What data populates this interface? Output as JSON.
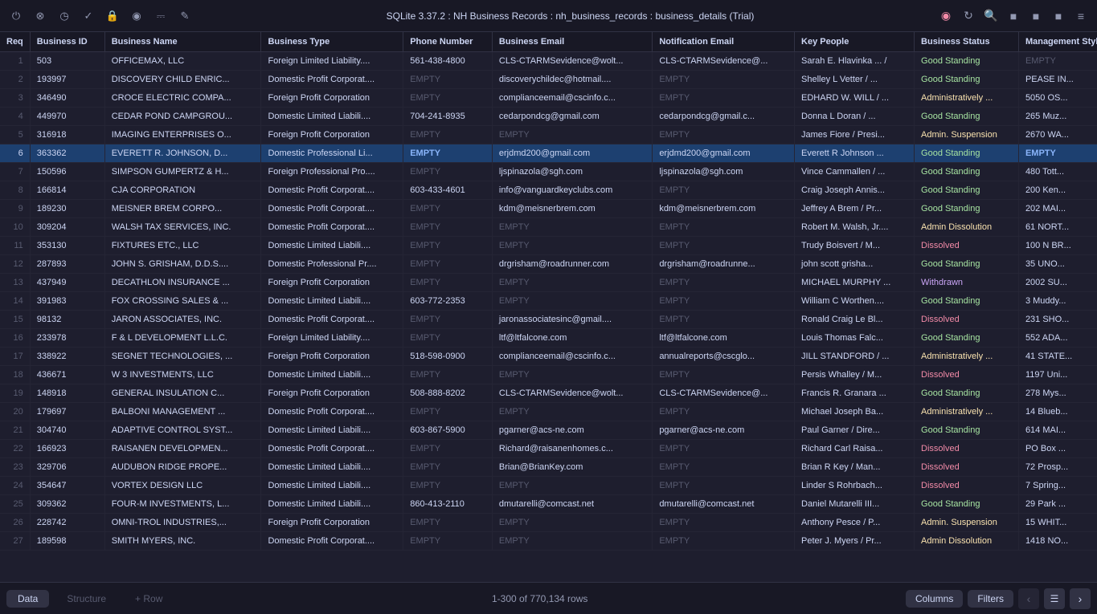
{
  "app": {
    "title": "SQLite 3.37.2  :  NH Business Records  :  nh_business_records  :  business_details (Trial)"
  },
  "titlebar": {
    "icons": [
      {
        "name": "power-icon",
        "symbol": "⏻"
      },
      {
        "name": "stop-icon",
        "symbol": "⊗"
      },
      {
        "name": "history-icon",
        "symbol": "◷"
      },
      {
        "name": "check-icon",
        "symbol": "✓"
      },
      {
        "name": "lock-icon",
        "symbol": "🔒"
      },
      {
        "name": "shield-icon",
        "symbol": "🛡"
      },
      {
        "name": "inbox-icon",
        "symbol": "⊟"
      },
      {
        "name": "edit-icon",
        "symbol": "✎"
      }
    ],
    "right_icons": [
      {
        "name": "stop-red-icon",
        "symbol": "⊗",
        "style": "red"
      },
      {
        "name": "refresh-icon",
        "symbol": "↻"
      },
      {
        "name": "search-icon",
        "symbol": "🔍"
      },
      {
        "name": "layout1-icon",
        "symbol": "⬜"
      },
      {
        "name": "layout2-icon",
        "symbol": "⬜"
      },
      {
        "name": "layout3-icon",
        "symbol": "⬜"
      },
      {
        "name": "menu-icon",
        "symbol": "≡"
      }
    ]
  },
  "columns": [
    {
      "id": "req",
      "label": "Req"
    },
    {
      "id": "business_id",
      "label": "Business ID"
    },
    {
      "id": "business_name",
      "label": "Business Name"
    },
    {
      "id": "business_type",
      "label": "Business Type"
    },
    {
      "id": "phone_number",
      "label": "Phone Number"
    },
    {
      "id": "business_email",
      "label": "Business Email"
    },
    {
      "id": "notification_email",
      "label": "Notification Email"
    },
    {
      "id": "key_people",
      "label": "Key People"
    },
    {
      "id": "business_status",
      "label": "Business Status"
    },
    {
      "id": "management_style",
      "label": "Management Style"
    }
  ],
  "rows": [
    {
      "num": "1",
      "id": "503",
      "name": "OFFICEMAX, LLC",
      "type": "Foreign Limited Liability....",
      "phone": "561-438-4800",
      "email": "CLS-CTARMSevidence@wolt...",
      "notif": "CLS-CTARMSevidence@...",
      "people": "Sarah E. Hlavinka ... /",
      "status": "Good Standing",
      "status_class": "status-good",
      "mgmt": "EMPTY",
      "mgmt_class": "empty",
      "selected": false
    },
    {
      "num": "2",
      "id": "193997",
      "name": "DISCOVERY CHILD ENRIC...",
      "type": "Domestic Profit Corporat....",
      "phone": "EMPTY",
      "email": "discoverychildec@hotmail....",
      "notif": "EMPTY",
      "people": "Shelley L Vetter / ...",
      "status": "Good Standing",
      "status_class": "status-good",
      "mgmt": "PEASE IN...",
      "mgmt_class": "",
      "selected": false
    },
    {
      "num": "3",
      "id": "346490",
      "name": "CROCE ELECTRIC COMPA...",
      "type": "Foreign Profit Corporation",
      "phone": "EMPTY",
      "email": "complianceemail@cscinfo.c...",
      "notif": "EMPTY",
      "people": "EDHARD W. WILL / ...",
      "status": "Administratively ...",
      "status_class": "status-admin",
      "mgmt": "5050 OS...",
      "mgmt_class": "",
      "selected": false
    },
    {
      "num": "4",
      "id": "449970",
      "name": "CEDAR POND CAMPGROU...",
      "type": "Domestic Limited Liabili....",
      "phone": "704-241-8935",
      "email": "cedarpondcg@gmail.com",
      "notif": "cedarpondcg@gmail.c...",
      "people": "Donna L Doran / ...",
      "status": "Good Standing",
      "status_class": "status-good",
      "mgmt": "265 Muz...",
      "mgmt_class": "",
      "selected": false
    },
    {
      "num": "5",
      "id": "316918",
      "name": "IMAGING ENTERPRISES O...",
      "type": "Foreign Profit Corporation",
      "phone": "EMPTY",
      "email": "EMPTY",
      "notif": "EMPTY",
      "people": "James Fiore / Presi...",
      "status": "Admin. Suspension",
      "status_class": "status-admin",
      "mgmt": "2670 WA...",
      "mgmt_class": "",
      "selected": false
    },
    {
      "num": "6",
      "id": "363362",
      "name": "EVERETT R. JOHNSON, D...",
      "type": "Domestic Professional Li...",
      "phone": "EMPTY",
      "email": "erjdmd200@gmail.com",
      "notif": "erjdmd200@gmail.com",
      "people": "Everett R Johnson ...",
      "status": "Good Standing",
      "status_class": "status-good",
      "mgmt": "EMPTY",
      "mgmt_class": "empty",
      "selected": true
    },
    {
      "num": "7",
      "id": "150596",
      "name": "SIMPSON GUMPERTZ & H...",
      "type": "Foreign Professional Pro....",
      "phone": "EMPTY",
      "email": "ljspinazola@sgh.com",
      "notif": "ljspinazola@sgh.com",
      "people": "Vince Cammallen / ...",
      "status": "Good Standing",
      "status_class": "status-good",
      "mgmt": "480 Tott...",
      "mgmt_class": "",
      "selected": false
    },
    {
      "num": "8",
      "id": "166814",
      "name": "CJA CORPORATION",
      "type": "Domestic Profit Corporat....",
      "phone": "603-433-4601",
      "email": "info@vanguardkeyclubs.com",
      "notif": "EMPTY",
      "people": "Craig Joseph Annis...",
      "status": "Good Standing",
      "status_class": "status-good",
      "mgmt": "200 Ken...",
      "mgmt_class": "",
      "selected": false
    },
    {
      "num": "9",
      "id": "189230",
      "name": "MEISNER BREM CORPO...",
      "type": "Domestic Profit Corporat....",
      "phone": "EMPTY",
      "email": "kdm@meisnerbrem.com",
      "notif": "kdm@meisnerbrem.com",
      "people": "Jeffrey A Brem / Pr...",
      "status": "Good Standing",
      "status_class": "status-good",
      "mgmt": "202 MAI...",
      "mgmt_class": "",
      "selected": false
    },
    {
      "num": "10",
      "id": "309204",
      "name": "WALSH TAX SERVICES, INC.",
      "type": "Domestic Profit Corporat....",
      "phone": "EMPTY",
      "email": "EMPTY",
      "notif": "EMPTY",
      "people": "Robert M. Walsh, Jr....",
      "status": "Admin Dissolution",
      "status_class": "status-admin",
      "mgmt": "61 NORT...",
      "mgmt_class": "",
      "selected": false
    },
    {
      "num": "11",
      "id": "353130",
      "name": "FIXTURES ETC., LLC",
      "type": "Domestic Limited Liabili....",
      "phone": "EMPTY",
      "email": "EMPTY",
      "notif": "EMPTY",
      "people": "Trudy Boisvert / M...",
      "status": "Dissolved",
      "status_class": "status-dissolved",
      "mgmt": "100 N BR...",
      "mgmt_class": "",
      "selected": false
    },
    {
      "num": "12",
      "id": "287893",
      "name": "JOHN S. GRISHAM, D.D.S....",
      "type": "Domestic Professional Pr....",
      "phone": "EMPTY",
      "email": "drgrisham@roadrunner.com",
      "notif": "drgrisham@roadrunne...",
      "people": "john scott grisha...",
      "status": "Good Standing",
      "status_class": "status-good",
      "mgmt": "35 UNO...",
      "mgmt_class": "",
      "selected": false
    },
    {
      "num": "13",
      "id": "437949",
      "name": "DECATHLON INSURANCE ...",
      "type": "Foreign Profit Corporation",
      "phone": "EMPTY",
      "email": "EMPTY",
      "notif": "EMPTY",
      "people": "MICHAEL MURPHY ...",
      "status": "Withdrawn",
      "status_class": "status-withdrawn",
      "mgmt": "2002 SU...",
      "mgmt_class": "",
      "selected": false
    },
    {
      "num": "14",
      "id": "391983",
      "name": "FOX CROSSING SALES & ...",
      "type": "Domestic Limited Liabili....",
      "phone": "603-772-2353",
      "email": "EMPTY",
      "notif": "EMPTY",
      "people": "William C Worthen....",
      "status": "Good Standing",
      "status_class": "status-good",
      "mgmt": "3 Muddy...",
      "mgmt_class": "",
      "selected": false
    },
    {
      "num": "15",
      "id": "98132",
      "name": "JARON ASSOCIATES, INC.",
      "type": "Domestic Profit Corporat....",
      "phone": "EMPTY",
      "email": "jaronassociatesinc@gmail....",
      "notif": "EMPTY",
      "people": "Ronald Craig Le Bl...",
      "status": "Dissolved",
      "status_class": "status-dissolved",
      "mgmt": "231 SHO...",
      "mgmt_class": "",
      "selected": false
    },
    {
      "num": "16",
      "id": "233978",
      "name": "F & L DEVELOPMENT L.L.C.",
      "type": "Foreign Limited Liability....",
      "phone": "EMPTY",
      "email": "ltf@ltfalcone.com",
      "notif": "ltf@ltfalcone.com",
      "people": "Louis Thomas Falc...",
      "status": "Good Standing",
      "status_class": "status-good",
      "mgmt": "552 ADA...",
      "mgmt_class": "",
      "selected": false
    },
    {
      "num": "17",
      "id": "338922",
      "name": "SEGNET TECHNOLOGIES, ...",
      "type": "Foreign Profit Corporation",
      "phone": "518-598-0900",
      "email": "complianceemail@cscinfo.c...",
      "notif": "annualreports@cscglo...",
      "people": "JILL STANDFORD / ...",
      "status": "Administratively ...",
      "status_class": "status-admin",
      "mgmt": "41 STATE...",
      "mgmt_class": "",
      "selected": false
    },
    {
      "num": "18",
      "id": "436671",
      "name": "W 3 INVESTMENTS, LLC",
      "type": "Domestic Limited Liabili....",
      "phone": "EMPTY",
      "email": "EMPTY",
      "notif": "EMPTY",
      "people": "Persis Whalley / M...",
      "status": "Dissolved",
      "status_class": "status-dissolved",
      "mgmt": "1197 Uni...",
      "mgmt_class": "",
      "selected": false
    },
    {
      "num": "19",
      "id": "148918",
      "name": "GENERAL INSULATION C...",
      "type": "Foreign Profit Corporation",
      "phone": "508-888-8202",
      "email": "CLS-CTARMSevidence@wolt...",
      "notif": "CLS-CTARMSevidence@...",
      "people": "Francis R. Granara ...",
      "status": "Good Standing",
      "status_class": "status-good",
      "mgmt": "278 Mys...",
      "mgmt_class": "",
      "selected": false
    },
    {
      "num": "20",
      "id": "179697",
      "name": "BALBONI MANAGEMENT ...",
      "type": "Domestic Profit Corporat....",
      "phone": "EMPTY",
      "email": "EMPTY",
      "notif": "EMPTY",
      "people": "Michael Joseph Ba...",
      "status": "Administratively ...",
      "status_class": "status-admin",
      "mgmt": "14 Blueb...",
      "mgmt_class": "",
      "selected": false
    },
    {
      "num": "21",
      "id": "304740",
      "name": "ADAPTIVE CONTROL SYST...",
      "type": "Domestic Limited Liabili....",
      "phone": "603-867-5900",
      "email": "pgarner@acs-ne.com",
      "notif": "pgarner@acs-ne.com",
      "people": "Paul Garner / Dire...",
      "status": "Good Standing",
      "status_class": "status-good",
      "mgmt": "614 MAI...",
      "mgmt_class": "",
      "selected": false
    },
    {
      "num": "22",
      "id": "166923",
      "name": "RAISANEN DEVELOPMEN...",
      "type": "Domestic Profit Corporat....",
      "phone": "EMPTY",
      "email": "Richard@raisanenhomes.c...",
      "notif": "EMPTY",
      "people": "Richard Carl Raisa...",
      "status": "Dissolved",
      "status_class": "status-dissolved",
      "mgmt": "PO Box ...",
      "mgmt_class": "",
      "selected": false
    },
    {
      "num": "23",
      "id": "329706",
      "name": "AUDUBON RIDGE PROPE...",
      "type": "Domestic Limited Liabili....",
      "phone": "EMPTY",
      "email": "Brian@BrianKey.com",
      "notif": "EMPTY",
      "people": "Brian R Key / Man...",
      "status": "Dissolved",
      "status_class": "status-dissolved",
      "mgmt": "72 Prosp...",
      "mgmt_class": "",
      "selected": false
    },
    {
      "num": "24",
      "id": "354647",
      "name": "VORTEX DESIGN LLC",
      "type": "Domestic Limited Liabili....",
      "phone": "EMPTY",
      "email": "EMPTY",
      "notif": "EMPTY",
      "people": "Linder S Rohrbach...",
      "status": "Dissolved",
      "status_class": "status-dissolved",
      "mgmt": "7 Spring...",
      "mgmt_class": "",
      "selected": false
    },
    {
      "num": "25",
      "id": "309362",
      "name": "FOUR-M INVESTMENTS, L...",
      "type": "Domestic Limited Liabili....",
      "phone": "860-413-2110",
      "email": "dmutarelli@comcast.net",
      "notif": "dmutarelli@comcast.net",
      "people": "Daniel Mutarelli III...",
      "status": "Good Standing",
      "status_class": "status-good",
      "mgmt": "29 Park ...",
      "mgmt_class": "",
      "selected": false
    },
    {
      "num": "26",
      "id": "228742",
      "name": "OMNI-TROL INDUSTRIES,...",
      "type": "Foreign Profit Corporation",
      "phone": "EMPTY",
      "email": "EMPTY",
      "notif": "EMPTY",
      "people": "Anthony Pesce / P...",
      "status": "Admin. Suspension",
      "status_class": "status-admin",
      "mgmt": "15 WHIT...",
      "mgmt_class": "",
      "selected": false
    },
    {
      "num": "27",
      "id": "189598",
      "name": "SMITH MYERS, INC.",
      "type": "Domestic Profit Corporat....",
      "phone": "EMPTY",
      "email": "EMPTY",
      "notif": "EMPTY",
      "people": "Peter J. Myers / Pr...",
      "status": "Admin Dissolution",
      "status_class": "status-admin",
      "mgmt": "1418 NO...",
      "mgmt_class": "",
      "selected": false
    }
  ],
  "bottombar": {
    "tabs": [
      {
        "label": "Data",
        "active": true
      },
      {
        "label": "Structure",
        "active": false
      },
      {
        "label": "+ Row",
        "active": false
      }
    ],
    "count": "1-300 of 770,134 rows",
    "buttons": [
      "Columns",
      "Filters"
    ],
    "nav_prev_disabled": true,
    "nav_next_disabled": false
  }
}
